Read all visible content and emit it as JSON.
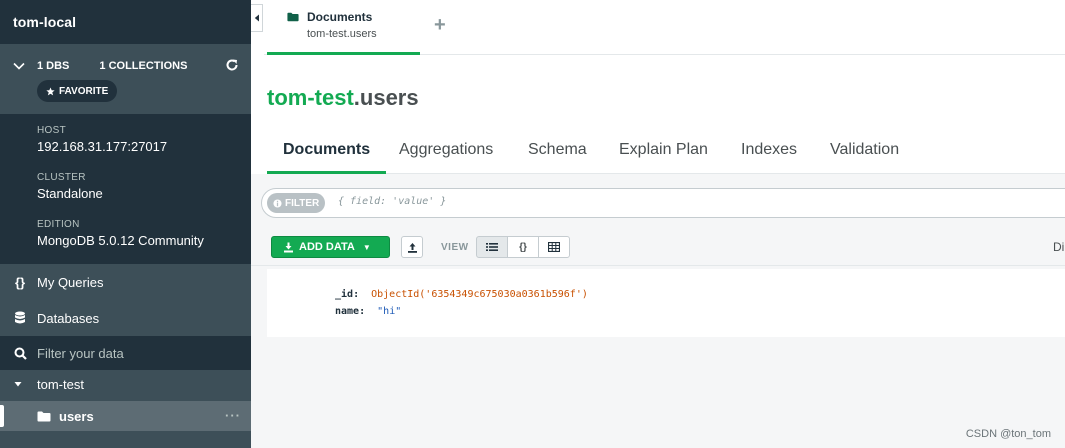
{
  "sidebar": {
    "connection_title": "tom-local",
    "stats": {
      "dbs": "1 DBS",
      "collections": "1 COLLECTIONS"
    },
    "favorite_label": "FAVORITE",
    "info": [
      {
        "label": "HOST",
        "value": "192.168.31.177:27017"
      },
      {
        "label": "CLUSTER",
        "value": "Standalone"
      },
      {
        "label": "EDITION",
        "value": "MongoDB 5.0.12 Community"
      }
    ],
    "nav": [
      {
        "label": "My Queries",
        "icon": "curly-braces-icon"
      },
      {
        "label": "Databases",
        "icon": "database-icon"
      }
    ],
    "filter_placeholder": "Filter your data",
    "database": "tom-test",
    "collection": "users",
    "collection_menu": "···"
  },
  "tabstrip": {
    "tab_title": "Documents",
    "tab_subtitle": "tom-test.users",
    "add_tab": "+"
  },
  "main": {
    "db_name": "tom-test",
    "collection_name": ".users",
    "subtabs": [
      "Documents",
      "Aggregations",
      "Schema",
      "Explain Plan",
      "Indexes",
      "Validation"
    ],
    "active_subtab": "Documents",
    "filter_label": "FILTER",
    "filter_placeholder": "{ field: 'value' }",
    "add_data_label": "ADD DATA",
    "view_label": "VIEW",
    "view_modes": [
      "list",
      "json",
      "table"
    ],
    "display_info": "Di"
  },
  "document": {
    "fields": [
      {
        "key": "_id",
        "value": "ObjectId('6354349c675030a0361b596f')",
        "type": "objectid"
      },
      {
        "key": "name",
        "value": "\"hi\"",
        "type": "string"
      }
    ]
  },
  "watermark": "CSDN @ton_tom",
  "colors": {
    "accent": "#13aa52",
    "sidebar": "#3d4f58",
    "sidebar_dark": "#21313c"
  }
}
